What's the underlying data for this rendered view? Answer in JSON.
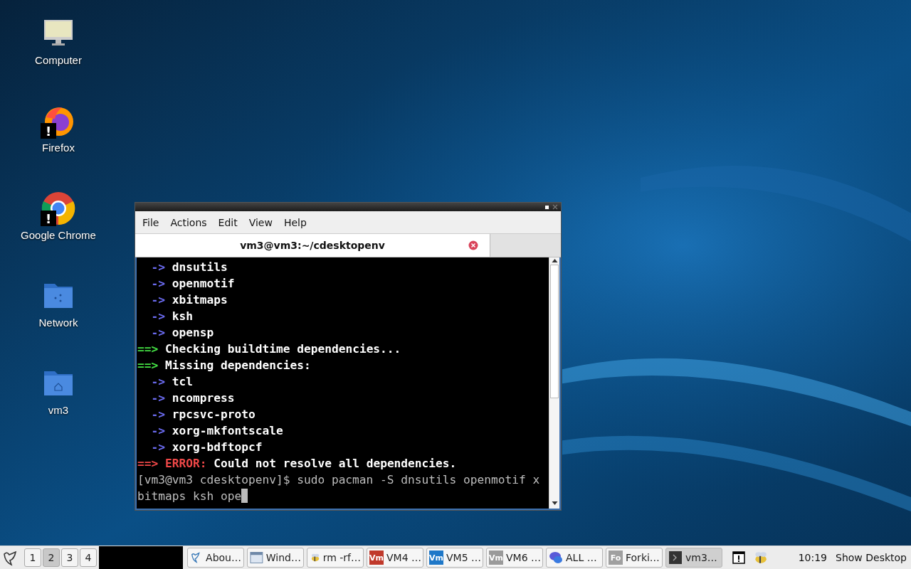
{
  "desktop_icons": [
    {
      "kind": "computer",
      "label": "Computer"
    },
    {
      "kind": "firefox",
      "label": "Firefox",
      "warning": "!"
    },
    {
      "kind": "chrome",
      "label": "Google Chrome",
      "warning": "!"
    },
    {
      "kind": "network",
      "label": "Network"
    },
    {
      "kind": "home",
      "label": "vm3"
    }
  ],
  "terminal": {
    "menu": [
      "File",
      "Actions",
      "Edit",
      "View",
      "Help"
    ],
    "tabs": [
      {
        "title": "vm3@vm3:~/cdesktopenv",
        "selected": true
      }
    ],
    "lines": [
      {
        "kind": "dep",
        "marker": "->",
        "text": "dnsutils"
      },
      {
        "kind": "dep",
        "marker": "->",
        "text": "openmotif"
      },
      {
        "kind": "dep",
        "marker": "->",
        "text": "xbitmaps"
      },
      {
        "kind": "dep",
        "marker": "->",
        "text": "ksh"
      },
      {
        "kind": "dep",
        "marker": "->",
        "text": "opensp"
      },
      {
        "kind": "step",
        "marker": "==>",
        "text": "Checking buildtime dependencies..."
      },
      {
        "kind": "step",
        "marker": "==>",
        "text": "Missing dependencies:"
      },
      {
        "kind": "dep",
        "marker": "->",
        "text": "tcl"
      },
      {
        "kind": "dep",
        "marker": "->",
        "text": "ncompress"
      },
      {
        "kind": "dep",
        "marker": "->",
        "text": "rpcsvc-proto"
      },
      {
        "kind": "dep",
        "marker": "->",
        "text": "xorg-mkfontscale"
      },
      {
        "kind": "dep",
        "marker": "->",
        "text": "xorg-bdftopcf"
      },
      {
        "kind": "error",
        "marker": "==>",
        "label": "ERROR:",
        "text": "Could not resolve all dependencies."
      },
      {
        "kind": "plain",
        "text": "[vm3@vm3 cdesktopenv]$ sudo pacman -S dnsutils openmotif x"
      },
      {
        "kind": "input",
        "text": "bitmaps ksh ope"
      }
    ]
  },
  "taskbar": {
    "workspaces": [
      {
        "label": "1",
        "selected": false
      },
      {
        "label": "2",
        "selected": true
      },
      {
        "label": "3",
        "selected": false
      },
      {
        "label": "4",
        "selected": false
      }
    ],
    "tasks": [
      {
        "kind": "bird",
        "label": "Abou…",
        "selected": false
      },
      {
        "kind": "window",
        "label": "Wind…",
        "selected": false
      },
      {
        "kind": "bee",
        "label": "rm -rf…",
        "selected": false
      },
      {
        "kind": "badge",
        "badge": "Vm",
        "color": "#c0392b",
        "label": "VM4 …",
        "selected": false
      },
      {
        "kind": "badge",
        "badge": "Vm",
        "color": "#1f78c8",
        "label": "VM5 …",
        "selected": false
      },
      {
        "kind": "badge",
        "badge": "Vm",
        "color": "#9a9a9a",
        "label": "VM6 …",
        "selected": false
      },
      {
        "kind": "chat",
        "label": "ALL …",
        "selected": false
      },
      {
        "kind": "badge",
        "badge": "Fo",
        "color": "#a0a0a0",
        "label": "Forki…",
        "selected": false
      },
      {
        "kind": "terminal",
        "label": "vm3…",
        "selected": true
      }
    ],
    "clock": "10:19",
    "show_desktop": "Show Desktop"
  }
}
